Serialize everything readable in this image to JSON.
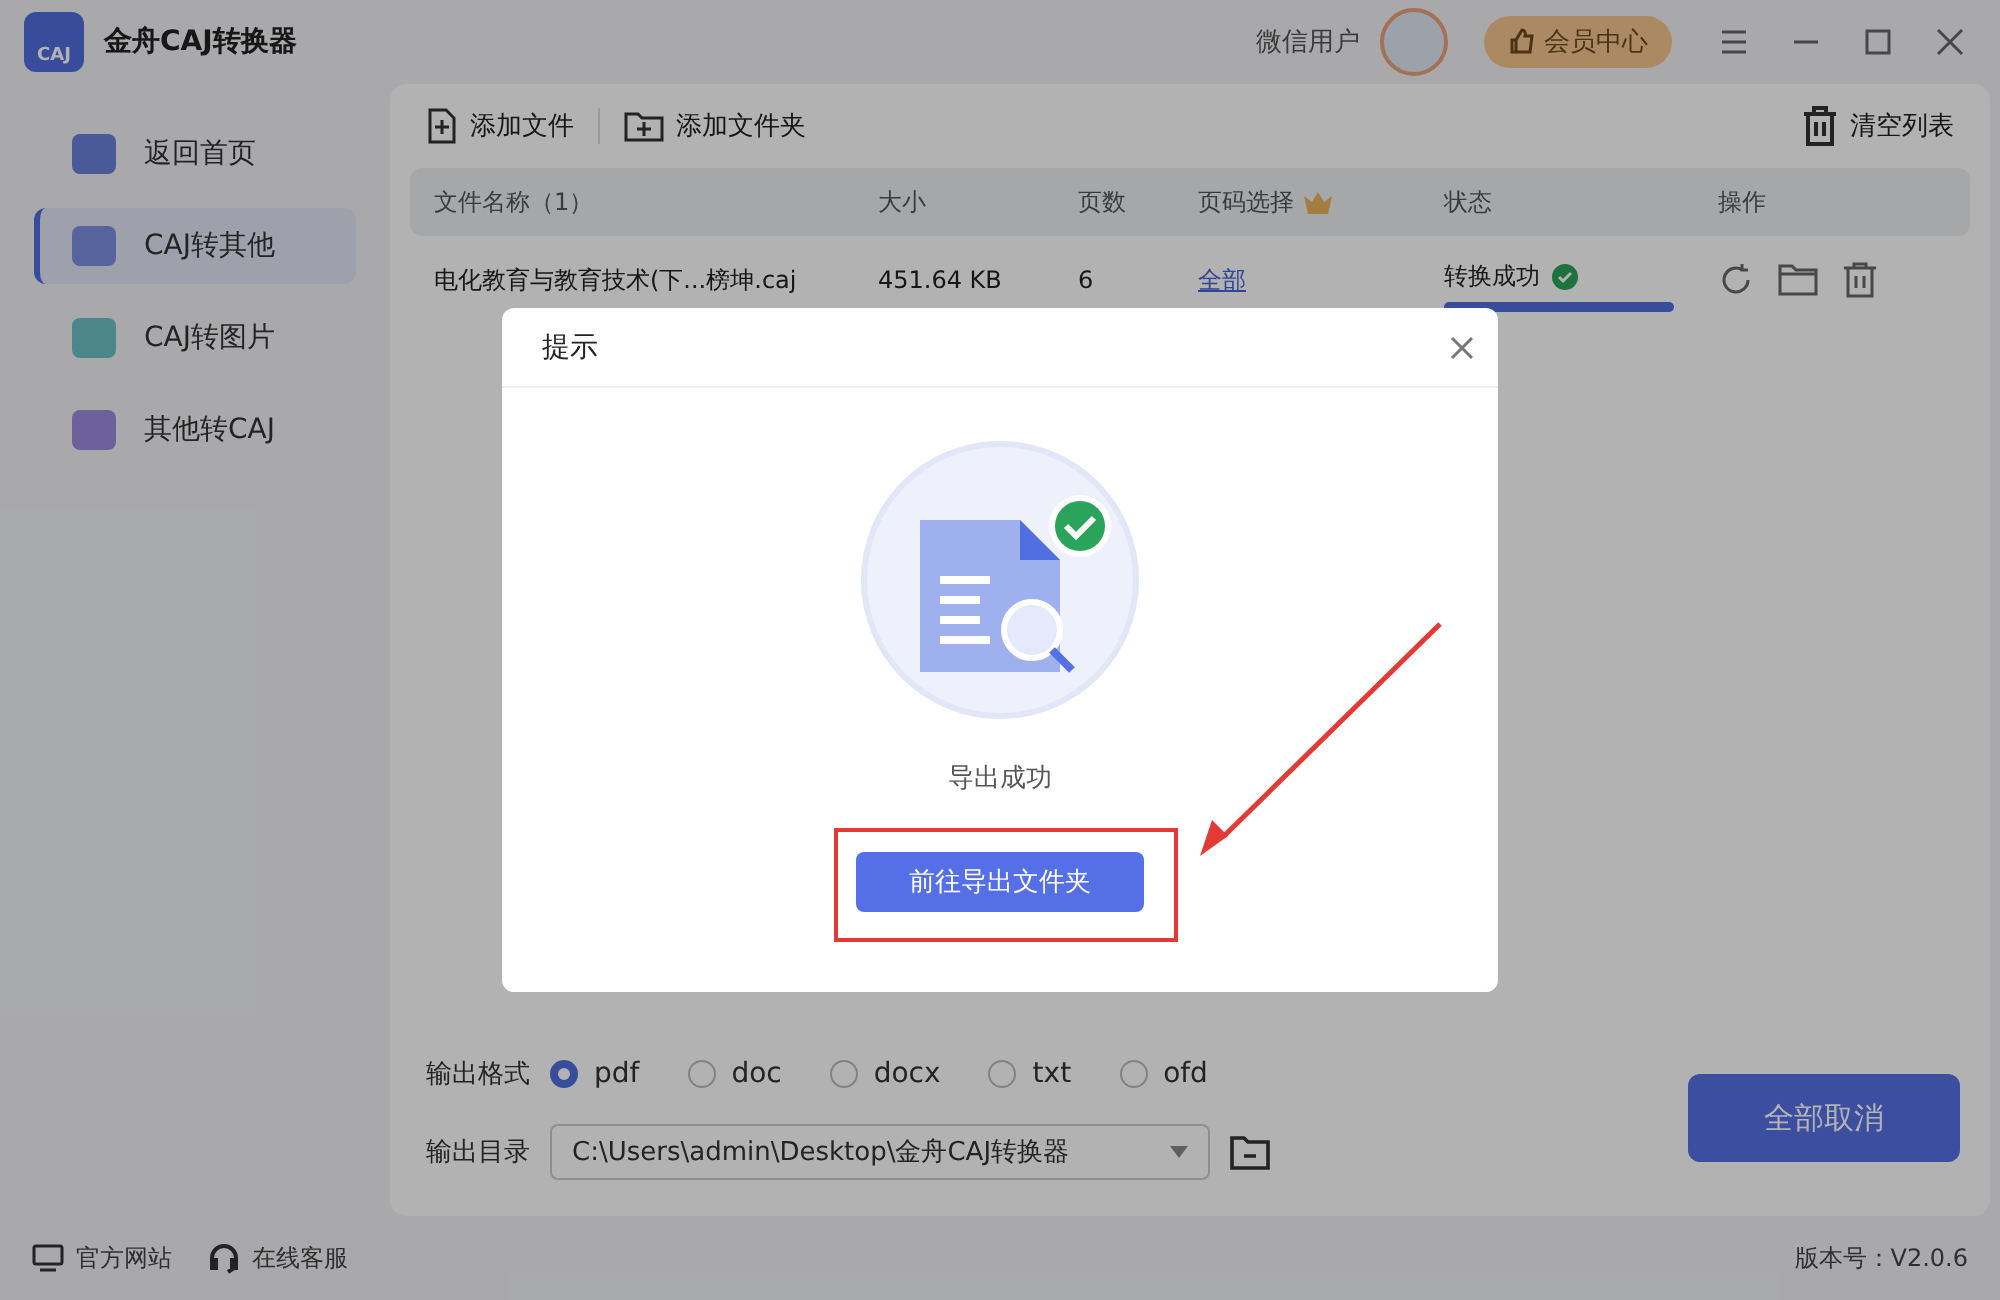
{
  "app": {
    "title": "金舟CAJ转换器",
    "logo": "CAJ",
    "user": "微信用户",
    "vip_button": "会员中心"
  },
  "sidebar": {
    "items": [
      {
        "label": "返回首页",
        "selected": false
      },
      {
        "label": "CAJ转其他",
        "selected": true
      },
      {
        "label": "CAJ转图片",
        "selected": false
      },
      {
        "label": "其他转CAJ",
        "selected": false
      }
    ]
  },
  "toolbar": {
    "add_file": "添加文件",
    "add_folder": "添加文件夹",
    "clear_list": "清空列表"
  },
  "table": {
    "columns": [
      "文件名称（1）",
      "大小",
      "页数",
      "页码选择",
      "状态",
      "操作"
    ],
    "rows": [
      {
        "name": "电化教育与教育技术(下...榜坤.caj",
        "size": "451.64 KB",
        "pages": "6",
        "page_range": "全部",
        "status": "转换成功",
        "level": 1
      }
    ]
  },
  "output": {
    "format_label": "输出格式",
    "formats": [
      {
        "label": "pdf",
        "selected": true
      },
      {
        "label": "doc",
        "selected": false
      },
      {
        "label": "docx",
        "selected": false
      },
      {
        "label": "txt",
        "selected": false
      },
      {
        "label": "ofd",
        "selected": false
      }
    ],
    "dir_label": "输出目录",
    "dir": "C:\\Users\\admin\\Desktop\\金舟CAJ转换器"
  },
  "cancel_all": "全部取消",
  "footer": {
    "website": "官方网站",
    "support": "在线客服",
    "version": "版本号：V2.0.6"
  },
  "dialog": {
    "title": "提示",
    "message": "导出成功",
    "button": "前往导出文件夹"
  }
}
